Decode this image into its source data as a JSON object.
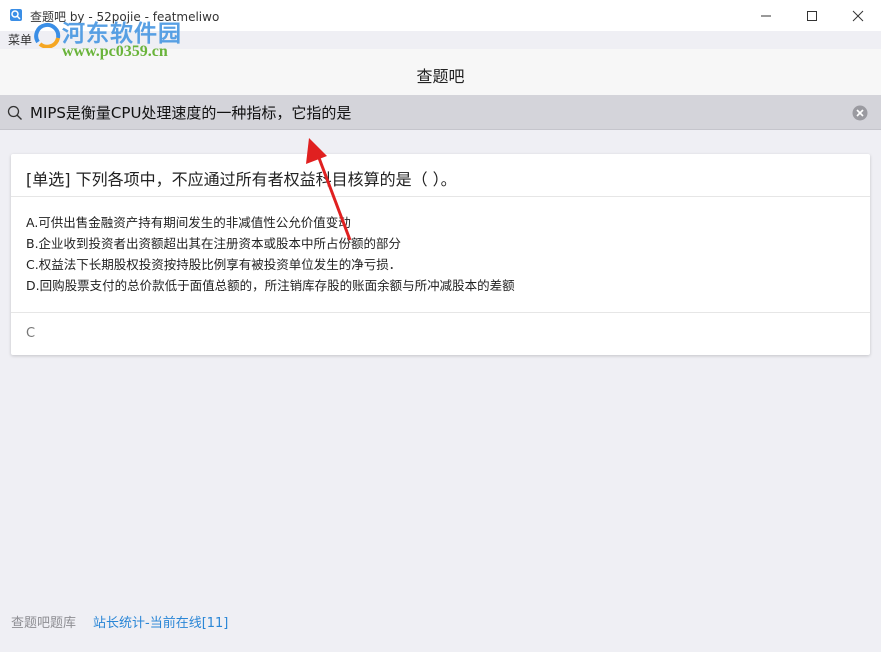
{
  "window": {
    "title": "查题吧 by - 52pojie - featmeliwo",
    "menu_label": "菜单",
    "controls": [
      "minimize",
      "maximize",
      "close"
    ]
  },
  "watermark": {
    "title": "河东软件园",
    "url": "www.pc0359.cn"
  },
  "navbar": {
    "title": "查题吧"
  },
  "search": {
    "value": "MIPS是衡量CPU处理速度的一种指标，它指的是",
    "icon": "search-icon",
    "clear_icon": "clear-icon"
  },
  "card": {
    "question": "[单选] 下列各项中，不应通过所有者权益科目核算的是（        ）。",
    "options": [
      "A.可供出售金融资产持有期间发生的非减值性公允价值变动",
      "B.企业收到投资者出资额超出其在注册资本或股本中所占份额的部分",
      "C.权益法下长期股权投资按持股比例享有被投资单位发生的净亏损．",
      "D.回购股票支付的总价款低于面值总额的，所注销库存股的账面余额与所冲减股本的差额"
    ],
    "answer": "C"
  },
  "footer": {
    "source": "查题吧题库",
    "stats_link": "站长统计-当前在线[11]"
  },
  "colors": {
    "background": "#efeff4",
    "search_bar": "#d4d4da",
    "link": "#2a86d6",
    "arrow": "#e02020"
  }
}
